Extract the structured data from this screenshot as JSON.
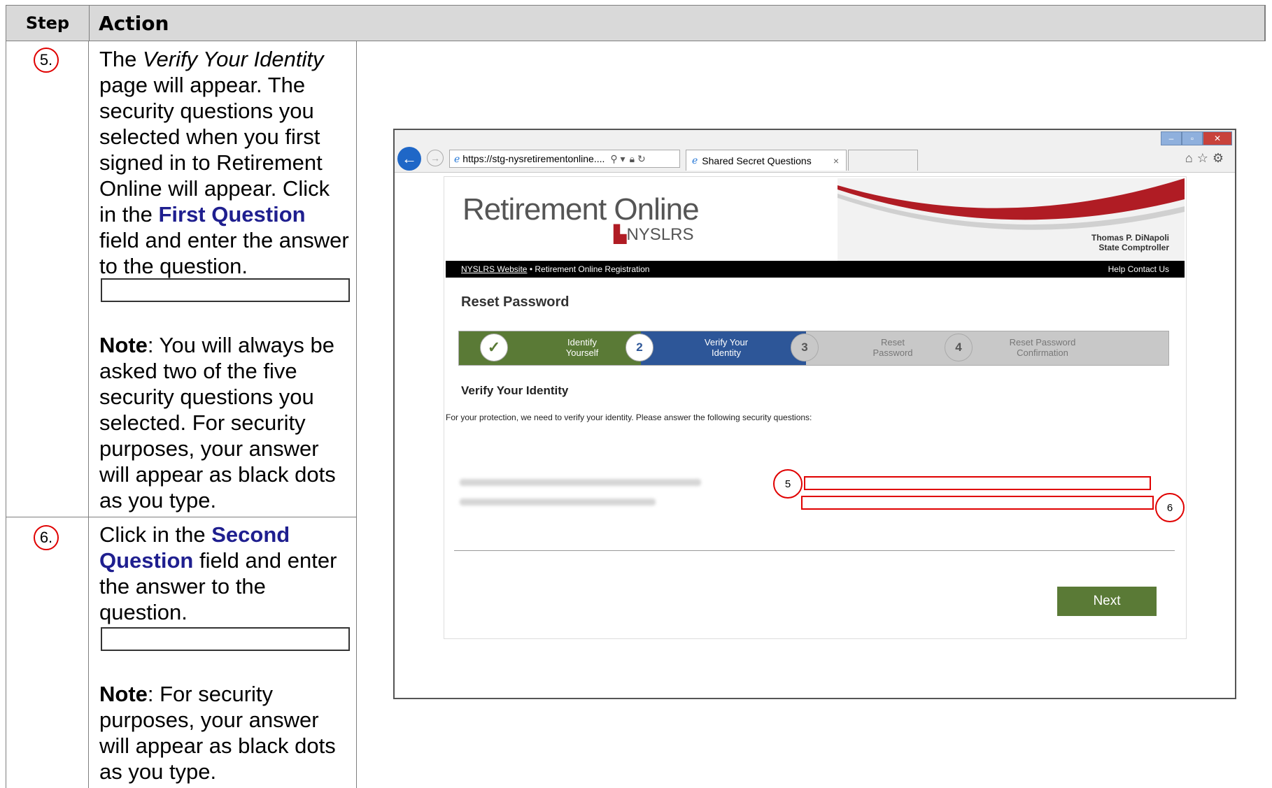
{
  "table": {
    "header_step": "Step",
    "header_action": "Action"
  },
  "row5": {
    "step": "5.",
    "text_1": "The ",
    "text_italic": "Verify Your Identity",
    "text_2": " page will appear. The security questions you selected when you first signed in to Retirement Online will appear. Click in the ",
    "field_name": "First Question",
    "text_3": " field and enter the answer to the question.",
    "note_label": "Note",
    "note_text": ": You will always be asked two of the five security questions you selected. For security purposes, your answer will appear as black dots as you type."
  },
  "row6": {
    "step": "6.",
    "text_1": "Click in the ",
    "field_name": "Second Question",
    "text_2": " field and enter the answer to the question.",
    "note_label": "Note",
    "note_text": ": For security purposes, your answer will appear as black dots as you type."
  },
  "browser": {
    "url": "https://stg-nysretirementonline....",
    "tab_title": "Shared Secret Questions",
    "tab_close": "×",
    "back_icon": "arrow-left-icon",
    "forward_icon": "arrow-right-icon",
    "window_buttons": [
      "minimize",
      "restore",
      "close"
    ],
    "toolbar_icons": [
      "home-icon",
      "star-icon",
      "gear-icon"
    ]
  },
  "site": {
    "logo": "Retirement Online",
    "logo_sub": "NYSLRS",
    "comptroller_name": "Thomas P. DiNapoli",
    "comptroller_title": "State Comptroller",
    "nav_link": "NYSLRS Website",
    "nav_sep": " • ",
    "nav_current": "Retirement Online Registration",
    "nav_right": "Help  Contact Us",
    "page_title": "Reset Password",
    "steps": [
      {
        "num": "✓",
        "label_1": "Identify",
        "label_2": "Yourself"
      },
      {
        "num": "2",
        "label_1": "Verify Your",
        "label_2": "Identity"
      },
      {
        "num": "3",
        "label_1": "Reset",
        "label_2": "Password"
      },
      {
        "num": "4",
        "label_1": "Reset Password",
        "label_2": "Confirmation"
      }
    ],
    "section_title": "Verify Your Identity",
    "protection_text": "For your protection, we need to verify your identity. Please answer the following security questions:",
    "callout_1": "5",
    "callout_2": "6",
    "next_label": "Next"
  },
  "colors": {
    "callout_red": "#e00000",
    "progress_green": "#5a7a36",
    "progress_blue": "#2d5698",
    "field_blue": "#1f1f8f"
  }
}
